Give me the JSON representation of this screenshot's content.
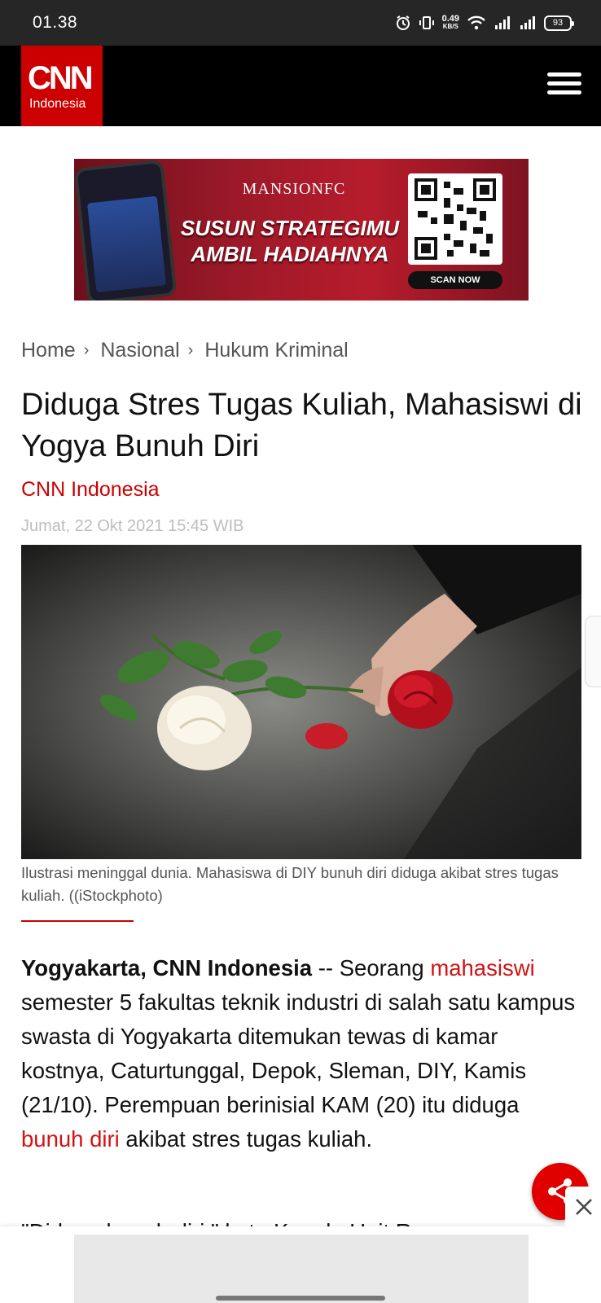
{
  "status_bar": {
    "time": "01.38",
    "net_speed_value": "0.49",
    "net_speed_unit": "KB/S",
    "battery": "93",
    "icons": [
      "alarm-icon",
      "vibrate-icon",
      "wifi-icon",
      "signal-icon",
      "signal-icon",
      "battery-icon"
    ]
  },
  "header": {
    "logo_main": "CNN",
    "logo_sub": "Indonesia",
    "menu_icon": "hamburger-menu-icon"
  },
  "ad_banner": {
    "brand": "MANSIONFC",
    "line1": "SUSUN STRATEGIMU",
    "line2": "AMBIL HADIAHNYA",
    "cta": "SCAN NOW"
  },
  "breadcrumb": {
    "items": [
      "Home",
      "Nasional",
      "Hukum Kriminal"
    ]
  },
  "article": {
    "title": "Diduga Stres Tugas Kuliah, Mahasiswi di Yogya Bunuh Diri",
    "author": "CNN Indonesia",
    "date": "Jumat, 22 Okt 2021 15:45 WIB",
    "caption": "Ilustrasi meninggal dunia. Mahasiswa di DIY bunuh diri diduga akibat stres tugas kuliah. ((iStockphoto)",
    "body": {
      "lead": "Yogyakarta, CNN Indonesia",
      "dash": " -- Seorang ",
      "link1": "mahasiswi",
      "part2": " semester 5 fakultas teknik industri di salah satu kampus swasta di Yogyakarta ditemukan tewas di kamar kostnya, Caturtunggal, Depok, Sleman, DIY, Kamis (21/10). Perempuan berinisial KAM (20) itu diduga ",
      "link2": "bunuh diri",
      "part3": " akibat stres tugas kuliah."
    },
    "next_paragraph": "\"Diduga bunuh diri,\" kata Kepala Unit Reserse"
  },
  "floating": {
    "share_icon": "share-icon",
    "close_icon": "close-icon"
  },
  "colors": {
    "brand_red": "#cc0000",
    "link_red": "#d31212",
    "header_bg": "#000000",
    "status_bg": "#262626"
  }
}
